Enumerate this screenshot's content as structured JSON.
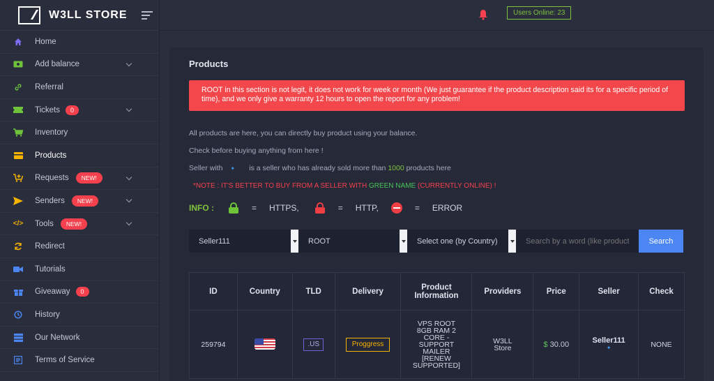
{
  "brand": {
    "name": "W3LL STORE"
  },
  "header": {
    "users_online": "Users Online: 23"
  },
  "sidebar": {
    "items": [
      {
        "label": "Home"
      },
      {
        "label": "Add balance"
      },
      {
        "label": "Referral"
      },
      {
        "label": "Tickets",
        "badge": "0"
      },
      {
        "label": "Inventory"
      },
      {
        "label": "Products"
      },
      {
        "label": "Requests",
        "badge": "NEW!"
      },
      {
        "label": "Senders",
        "badge": "NEW!"
      },
      {
        "label": "Tools",
        "badge": "NEW!"
      },
      {
        "label": "Redirect"
      },
      {
        "label": "Tutorials"
      },
      {
        "label": "Giveaway",
        "badge": "0"
      },
      {
        "label": "History"
      },
      {
        "label": "Our Network"
      },
      {
        "label": "Terms of Service"
      }
    ]
  },
  "main": {
    "title": "Products",
    "alert": "ROOT in this section is not legit, it does not work for week or month (We just guarantee if the product description said its for a specific period of time), and we only give a warranty 12 hours to open the report for any problem!",
    "info1": "All products are here, you can directly buy product using your balance.",
    "info2": "Check before buying anything from here !",
    "info3_a": "Seller with",
    "info3_b": "is a seller who has already sold more than",
    "info3_num": "1000",
    "info3_c": "products here",
    "note_a": "*NOTE : IT'S BETTER TO BUY FROM A SELLER WITH",
    "note_green": "GREEN NAME",
    "note_b": "(CURRENTLY ONLINE) !",
    "legend": {
      "label": "INFO :",
      "eq": "=",
      "https": "HTTPS,",
      "http": "HTTP,",
      "error": "ERROR"
    },
    "filters": {
      "seller": "Seller111",
      "type": "ROOT",
      "country": "Select one (by Country)",
      "search_placeholder": "Search by a word (like products)",
      "search_button": "Search"
    },
    "table": {
      "headers": [
        "ID",
        "Country",
        "TLD",
        "Delivery",
        "Product Information",
        "Providers",
        "Price",
        "Seller",
        "Check"
      ],
      "row": {
        "id": "259794",
        "tld": ".US",
        "delivery": "Proggress",
        "info": "VPS ROOT 8GB RAM 2 CORE - SUPPORT MAILER [RENEW SUPPORTED]",
        "provider": "W3LL Store",
        "price_currency": "$",
        "price_value": "30.00",
        "seller": "Seller111",
        "check": "NONE"
      }
    }
  },
  "colors": {
    "accent": "#4b86f2",
    "alert": "#f4474c",
    "green": "#7ec33c",
    "badge": "#f4414d"
  }
}
